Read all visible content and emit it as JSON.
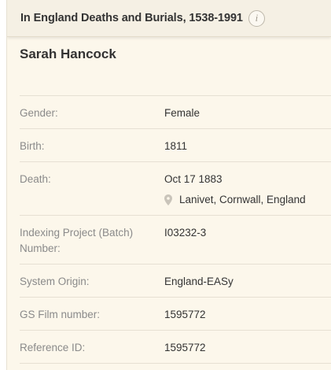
{
  "header": {
    "title": "In England Deaths and Burials, 1538-1991",
    "info_glyph": "i"
  },
  "record": {
    "name": "Sarah Hancock",
    "fields": [
      {
        "label": "Gender:",
        "value": "Female"
      },
      {
        "label": "Birth:",
        "value": "1811"
      },
      {
        "label": "Death:",
        "value": "Oct 17 1883",
        "place": "Lanivet, Cornwall, England"
      },
      {
        "label": "Indexing Project (Batch) Number:",
        "value": "I03232-3"
      },
      {
        "label": "System Origin:",
        "value": "England-EASy"
      },
      {
        "label": "GS Film number:",
        "value": "1595772"
      },
      {
        "label": "Reference ID:",
        "value": "1595772"
      }
    ]
  },
  "icons": {
    "info": "info-icon",
    "place": "map-pin-icon"
  },
  "colors": {
    "background": "#fcf7eb",
    "header_background": "#f5f0e4",
    "label_text": "#8a8a8a",
    "value_text": "#333333"
  }
}
